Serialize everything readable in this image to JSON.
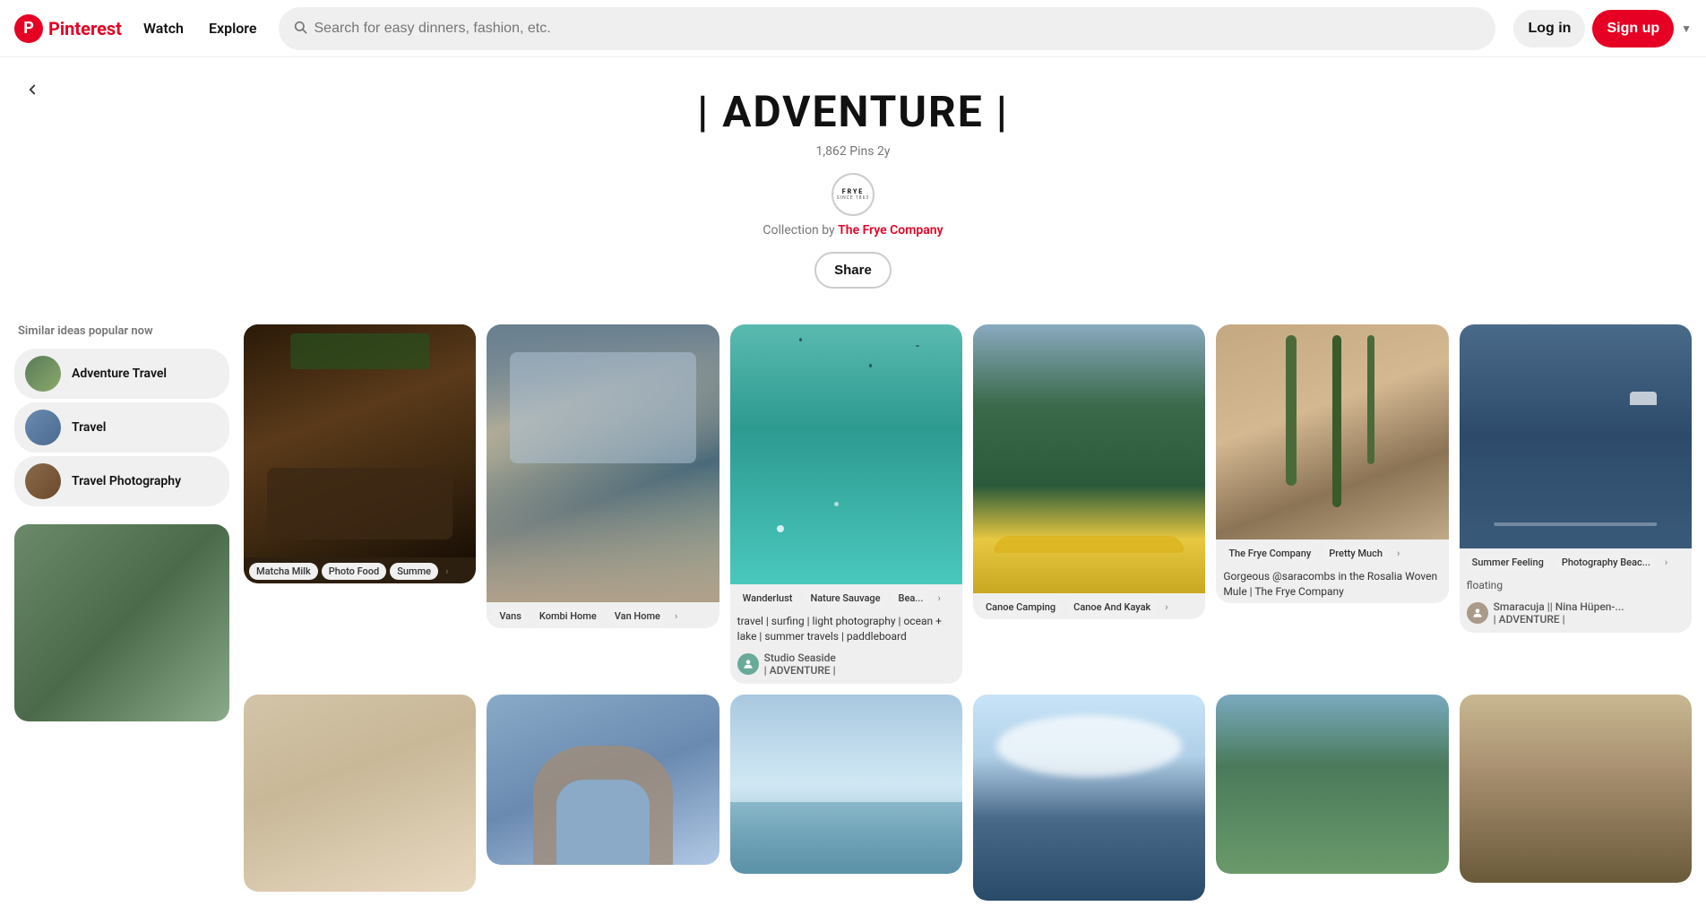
{
  "header": {
    "logo_text": "Pinterest",
    "nav": [
      {
        "label": "Watch",
        "id": "watch"
      },
      {
        "label": "Explore",
        "id": "explore"
      }
    ],
    "search_placeholder": "Search for easy dinners, fashion, etc.",
    "login_label": "Log in",
    "signup_label": "Sign up"
  },
  "board": {
    "title": "| ADVENTURE |",
    "pins_count": "1,862 Pins",
    "age": "2y",
    "collection_prefix": "Collection by",
    "collection_author": "The Frye Company",
    "share_label": "Share",
    "frye_logo_top": "FRYE",
    "frye_logo_bot": "SINCE 1863"
  },
  "sidebar": {
    "title": "Similar ideas popular now",
    "items": [
      {
        "label": "Adventure Travel",
        "id": "adventure-travel"
      },
      {
        "label": "Travel",
        "id": "travel"
      },
      {
        "label": "Travel Photography",
        "id": "travel-photography"
      }
    ]
  },
  "pins": [
    {
      "id": "pin-1",
      "tags": [
        "Matcha Milk",
        "Photo Food",
        "Summer"
      ],
      "has_more": true,
      "height": "tall",
      "color": "food-dark"
    },
    {
      "id": "pin-2",
      "tags": [
        "Vans",
        "Kombi Home",
        "Van Home"
      ],
      "has_more": true,
      "height": "xtall",
      "color": "van-interior"
    },
    {
      "id": "pin-3",
      "tags": [
        "Wanderlust",
        "Nature Sauvage",
        "Bea..."
      ],
      "has_more": true,
      "height": "xtall",
      "color": "teal-water",
      "desc": "travel | surfing | light photography | ocean + lake | summer travels | paddleboard",
      "user": "Studio Seaside",
      "user_board": "| ADVENTURE |"
    },
    {
      "id": "pin-4",
      "tags": [
        "Canoe Camping",
        "Canoe And Kayak"
      ],
      "has_more": true,
      "height": "xtall",
      "color": "forest-lake"
    },
    {
      "id": "pin-5",
      "tags": [
        "The Frye Company",
        "Pretty Much"
      ],
      "has_more": true,
      "height": "tall",
      "color": "cactus",
      "desc": "Gorgeous @saracombs in the Rosalia Woven Mule | The Frye Company"
    },
    {
      "id": "pin-6",
      "tags": [
        "Summer Feeling",
        "Photography Beac..."
      ],
      "has_more": true,
      "height": "tall",
      "color": "ocean-boat",
      "extra": "floating",
      "user_name": "Smaracuja || Nina Hüpen-...",
      "user_board": "| ADVENTURE |"
    },
    {
      "id": "pin-7",
      "tags": [],
      "height": "tall",
      "color": "picnic"
    },
    {
      "id": "pin-8",
      "tags": [],
      "height": "med",
      "color": "rock-arch"
    },
    {
      "id": "pin-9",
      "tags": [],
      "height": "med",
      "color": "glacier"
    },
    {
      "id": "pin-10",
      "tags": [],
      "height": "tall",
      "color": "clouds"
    },
    {
      "id": "pin-11",
      "tags": [],
      "height": "med",
      "color": "mountain-valley"
    },
    {
      "id": "pin-12",
      "tags": [],
      "height": "med",
      "color": "sunset-mountain"
    }
  ]
}
